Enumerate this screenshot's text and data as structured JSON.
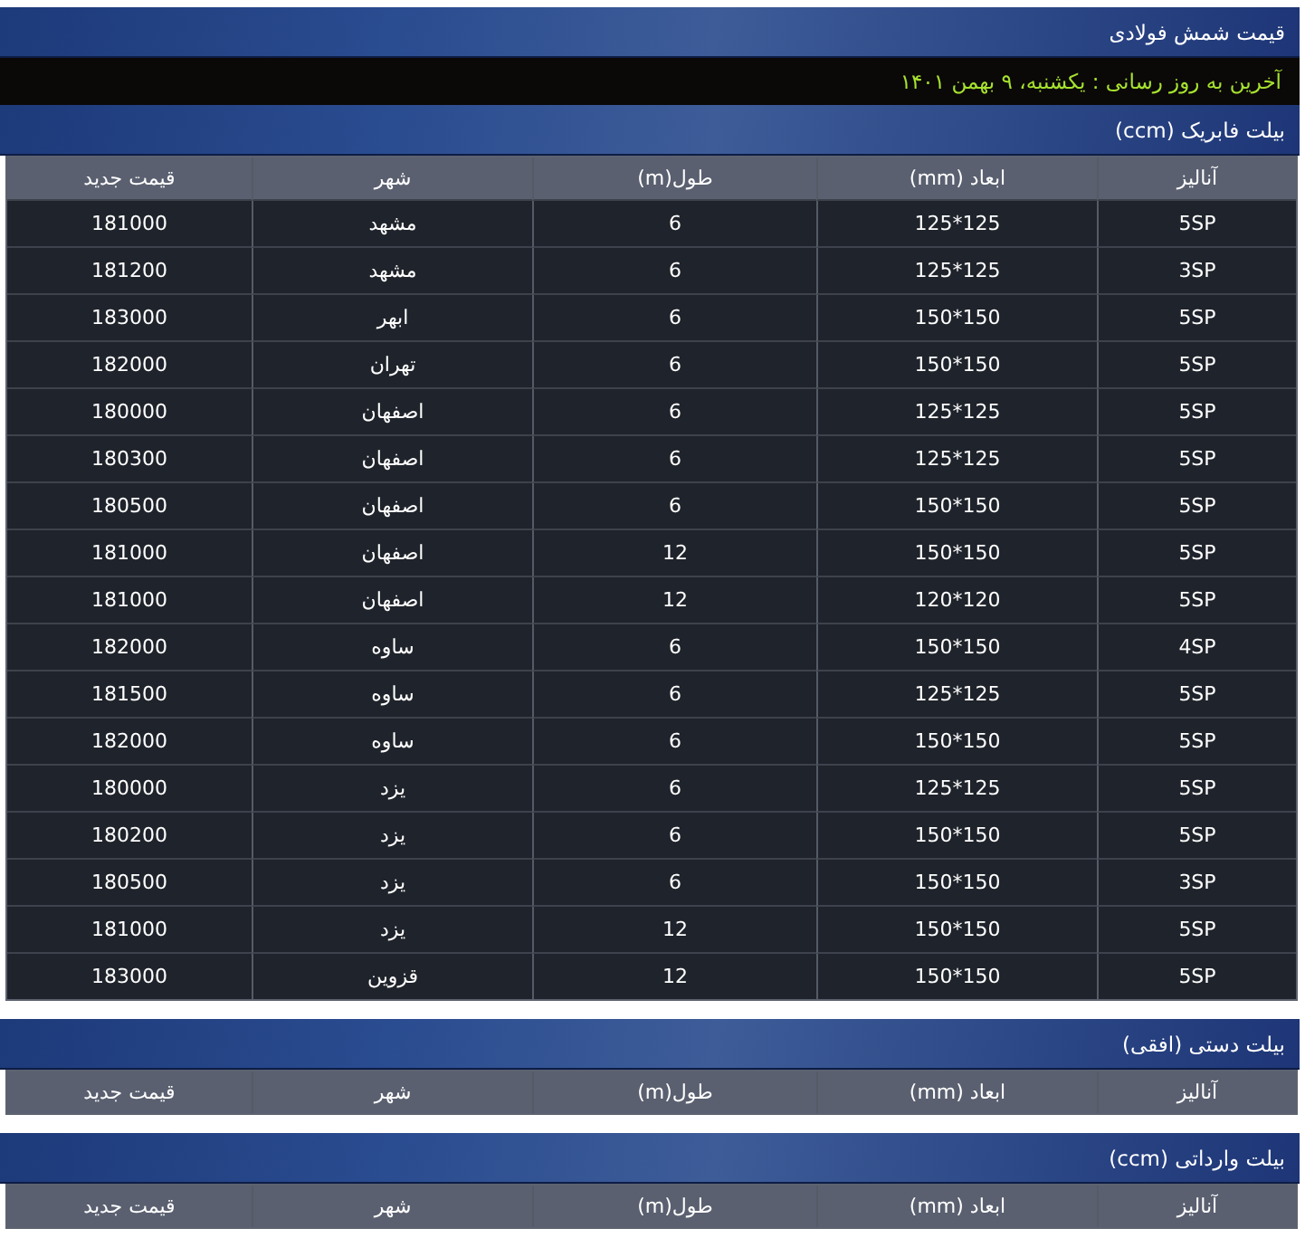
{
  "page_title": "قیمت شمش فولادی",
  "last_update": "آخرین به روز رسانی : یکشنبه، ۹ بهمن ۱۴۰۱",
  "sections": [
    {
      "title": "بیلت فابریک (ccm)",
      "columns": [
        "آنالیز",
        "ابعاد (mm)",
        "طول(m)",
        "شهر",
        "قیمت جدید"
      ],
      "rows": [
        [
          "5SP",
          "125*125",
          "6",
          "مشهد",
          "181000"
        ],
        [
          "3SP",
          "125*125",
          "6",
          "مشهد",
          "181200"
        ],
        [
          "5SP",
          "150*150",
          "6",
          "ابهر",
          "183000"
        ],
        [
          "5SP",
          "150*150",
          "6",
          "تهران",
          "182000"
        ],
        [
          "5SP",
          "125*125",
          "6",
          "اصفهان",
          "180000"
        ],
        [
          "5SP",
          "125*125",
          "6",
          "اصفهان",
          "180300"
        ],
        [
          "5SP",
          "150*150",
          "6",
          "اصفهان",
          "180500"
        ],
        [
          "5SP",
          "150*150",
          "12",
          "اصفهان",
          "181000"
        ],
        [
          "5SP",
          "120*120",
          "12",
          "اصفهان",
          "181000"
        ],
        [
          "4SP",
          "150*150",
          "6",
          "ساوه",
          "182000"
        ],
        [
          "5SP",
          "125*125",
          "6",
          "ساوه",
          "181500"
        ],
        [
          "5SP",
          "150*150",
          "6",
          "ساوه",
          "182000"
        ],
        [
          "5SP",
          "125*125",
          "6",
          "یزد",
          "180000"
        ],
        [
          "5SP",
          "150*150",
          "6",
          "یزد",
          "180200"
        ],
        [
          "3SP",
          "150*150",
          "6",
          "یزد",
          "180500"
        ],
        [
          "5SP",
          "150*150",
          "12",
          "یزد",
          "181000"
        ],
        [
          "5SP",
          "150*150",
          "12",
          "قزوین",
          "183000"
        ]
      ]
    },
    {
      "title": "بیلت دستی (افقی)",
      "columns": [
        "آنالیز",
        "ابعاد (mm)",
        "طول(m)",
        "شهر",
        "قیمت جدید"
      ]
    },
    {
      "title": "بیلت وارداتی (ccm)",
      "columns": [
        "آنالیز",
        "ابعاد (mm)",
        "طول(m)",
        "شهر",
        "قیمت جدید"
      ]
    }
  ]
}
